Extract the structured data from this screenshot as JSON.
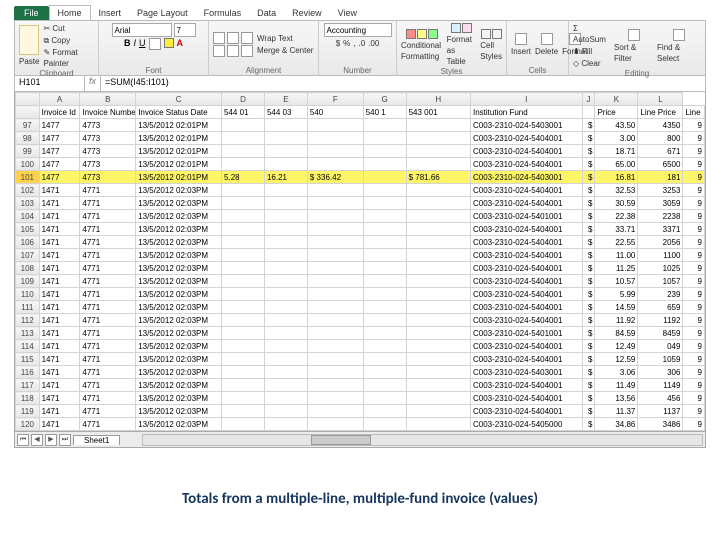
{
  "tabs": {
    "file": "File",
    "home": "Home",
    "insert": "Insert",
    "pagelayout": "Page Layout",
    "formulas": "Formulas",
    "data": "Data",
    "review": "Review",
    "view": "View"
  },
  "ribbon": {
    "clipboard": {
      "label": "Clipboard",
      "paste": "Paste",
      "cut": "Cut",
      "copy": "Copy",
      "fp": "Format Painter"
    },
    "font": {
      "label": "Font",
      "name": "Arial",
      "size": "7"
    },
    "alignment": {
      "label": "Alignment",
      "wrap": "Wrap Text",
      "merge": "Merge & Center"
    },
    "number": {
      "label": "Number",
      "format": "Accounting"
    },
    "styles": {
      "label": "Styles",
      "cf": "Conditional Formatting",
      "fmt": "Format as Table",
      "cell": "Cell Styles"
    },
    "cells": {
      "label": "Cells",
      "ins": "Insert",
      "del": "Delete",
      "fmt": "Format"
    },
    "editing": {
      "label": "Editing",
      "sum": "AutoSum",
      "fill": "Fill",
      "clear": "Clear",
      "sort": "Sort & Filter",
      "find": "Find & Select"
    }
  },
  "namebox": "H101",
  "formula": "=SUM(I45:I101)",
  "cols": [
    "",
    "A",
    "B",
    "C",
    "D",
    "E",
    "F",
    "G",
    "H",
    "I",
    "J",
    "K",
    "L"
  ],
  "headers": [
    "Invoice Id",
    "Invoice Number",
    "Invoice Status Date",
    "544 01",
    "544 03",
    "540",
    "540 1",
    "543 001",
    "Institution Fund",
    "",
    "Price",
    "Line Price",
    "Line"
  ],
  "rows": [
    {
      "n": "97",
      "c": [
        "1477",
        "4773",
        "13/5/2012 02:01PM",
        "",
        "",
        "",
        "",
        "",
        "C003-2310-024-5403001",
        "$",
        "43.50",
        "4350",
        "9"
      ]
    },
    {
      "n": "98",
      "c": [
        "1477",
        "4773",
        "13/5/2012 02:01PM",
        "",
        "",
        "",
        "",
        "",
        "C003-2310-024-5404001",
        "$",
        "3.00",
        "800",
        "9"
      ]
    },
    {
      "n": "99",
      "c": [
        "1477",
        "4773",
        "13/5/2012 02:01PM",
        "",
        "",
        "",
        "",
        "",
        "C003-2310-024-5404001",
        "$",
        "18.71",
        "671",
        "9"
      ]
    },
    {
      "n": "100",
      "c": [
        "1477",
        "4773",
        "13/5/2012 02:01PM",
        "",
        "",
        "",
        "",
        "",
        "C003-2310-024-5404001",
        "$",
        "65.00",
        "6500",
        "9"
      ]
    },
    {
      "n": "101",
      "sel": true,
      "c": [
        "1477",
        "4773",
        "13/5/2012 02:01PM",
        "5.28",
        "16.21",
        "$       336.42",
        "",
        "$        781.66",
        "C003-2310-024-5403001",
        "$",
        "16.81",
        "181",
        "9"
      ]
    },
    {
      "n": "102",
      "c": [
        "1471",
        "4771",
        "13/5/2012 02:03PM",
        "",
        "",
        "",
        "",
        "",
        "C003-2310-024-5404001",
        "$",
        "32.53",
        "3253",
        "9"
      ]
    },
    {
      "n": "103",
      "c": [
        "1471",
        "4771",
        "13/5/2012 02:03PM",
        "",
        "",
        "",
        "",
        "",
        "C003-2310-024-5404001",
        "$",
        "30.59",
        "3059",
        "9"
      ]
    },
    {
      "n": "104",
      "c": [
        "1471",
        "4771",
        "13/5/2012 02:03PM",
        "",
        "",
        "",
        "",
        "",
        "C003-2310-024-5401001",
        "$",
        "22.38",
        "2238",
        "9"
      ]
    },
    {
      "n": "105",
      "c": [
        "1471",
        "4771",
        "13/5/2012 02:03PM",
        "",
        "",
        "",
        "",
        "",
        "C003-2310-024-5404001",
        "$",
        "33.71",
        "3371",
        "9"
      ]
    },
    {
      "n": "106",
      "c": [
        "1471",
        "4771",
        "13/5/2012 02:03PM",
        "",
        "",
        "",
        "",
        "",
        "C003-2310-024-5404001",
        "$",
        "22.55",
        "2056",
        "9"
      ]
    },
    {
      "n": "107",
      "c": [
        "1471",
        "4771",
        "13/5/2012 02:03PM",
        "",
        "",
        "",
        "",
        "",
        "C003-2310-024-5404001",
        "$",
        "11.00",
        "1100",
        "9"
      ]
    },
    {
      "n": "108",
      "c": [
        "1471",
        "4771",
        "13/5/2012 02:03PM",
        "",
        "",
        "",
        "",
        "",
        "C003-2310-024-5404001",
        "$",
        "11.25",
        "1025",
        "9"
      ]
    },
    {
      "n": "109",
      "c": [
        "1471",
        "4771",
        "13/5/2012 02:03PM",
        "",
        "",
        "",
        "",
        "",
        "C003-2310-024-5404001",
        "$",
        "10.57",
        "1057",
        "9"
      ]
    },
    {
      "n": "110",
      "c": [
        "1471",
        "4771",
        "13/5/2012 02:03PM",
        "",
        "",
        "",
        "",
        "",
        "C003-2310-024-5404001",
        "$",
        "5.99",
        "239",
        "9"
      ]
    },
    {
      "n": "111",
      "c": [
        "1471",
        "4771",
        "13/5/2012 02:03PM",
        "",
        "",
        "",
        "",
        "",
        "C003-2310-024-5404001",
        "$",
        "14.59",
        "659",
        "9"
      ]
    },
    {
      "n": "112",
      "c": [
        "1471",
        "4771",
        "13/5/2012 02:03PM",
        "",
        "",
        "",
        "",
        "",
        "C003-2310-024-5404001",
        "$",
        "11.92",
        "1192",
        "9"
      ]
    },
    {
      "n": "113",
      "c": [
        "1471",
        "4771",
        "13/5/2012 02:03PM",
        "",
        "",
        "",
        "",
        "",
        "C003-2310-024-5401001",
        "$",
        "84.59",
        "8459",
        "9"
      ]
    },
    {
      "n": "114",
      "c": [
        "1471",
        "4771",
        "13/5/2012 02:03PM",
        "",
        "",
        "",
        "",
        "",
        "C003-2310-024-5404001",
        "$",
        "12.49",
        "049",
        "9"
      ]
    },
    {
      "n": "115",
      "c": [
        "1471",
        "4771",
        "13/5/2012 02:03PM",
        "",
        "",
        "",
        "",
        "",
        "C003-2310-024-5404001",
        "$",
        "12.59",
        "1059",
        "9"
      ]
    },
    {
      "n": "116",
      "c": [
        "1471",
        "4771",
        "13/5/2012 02:03PM",
        "",
        "",
        "",
        "",
        "",
        "C003-2310-024-5403001",
        "$",
        "3.06",
        "306",
        "9"
      ]
    },
    {
      "n": "117",
      "c": [
        "1471",
        "4771",
        "13/5/2012 02:03PM",
        "",
        "",
        "",
        "",
        "",
        "C003-2310-024-5404001",
        "$",
        "11.49",
        "1149",
        "9"
      ]
    },
    {
      "n": "118",
      "c": [
        "1471",
        "4771",
        "13/5/2012 02:03PM",
        "",
        "",
        "",
        "",
        "",
        "C003-2310-024-5404001",
        "$",
        "13.56",
        "456",
        "9"
      ]
    },
    {
      "n": "119",
      "c": [
        "1471",
        "4771",
        "13/5/2012 02:03PM",
        "",
        "",
        "",
        "",
        "",
        "C003-2310-024-5404001",
        "$",
        "11.37",
        "1137",
        "9"
      ]
    },
    {
      "n": "120",
      "c": [
        "1471",
        "4771",
        "13/5/2012 02:03PM",
        "",
        "",
        "",
        "",
        "",
        "C003-2310-024-5405000",
        "$",
        "34.86",
        "3486",
        "9"
      ]
    }
  ],
  "sheet": "Sheet1",
  "caption": "Totals from a multiple-line, multiple-fund invoice (values)"
}
